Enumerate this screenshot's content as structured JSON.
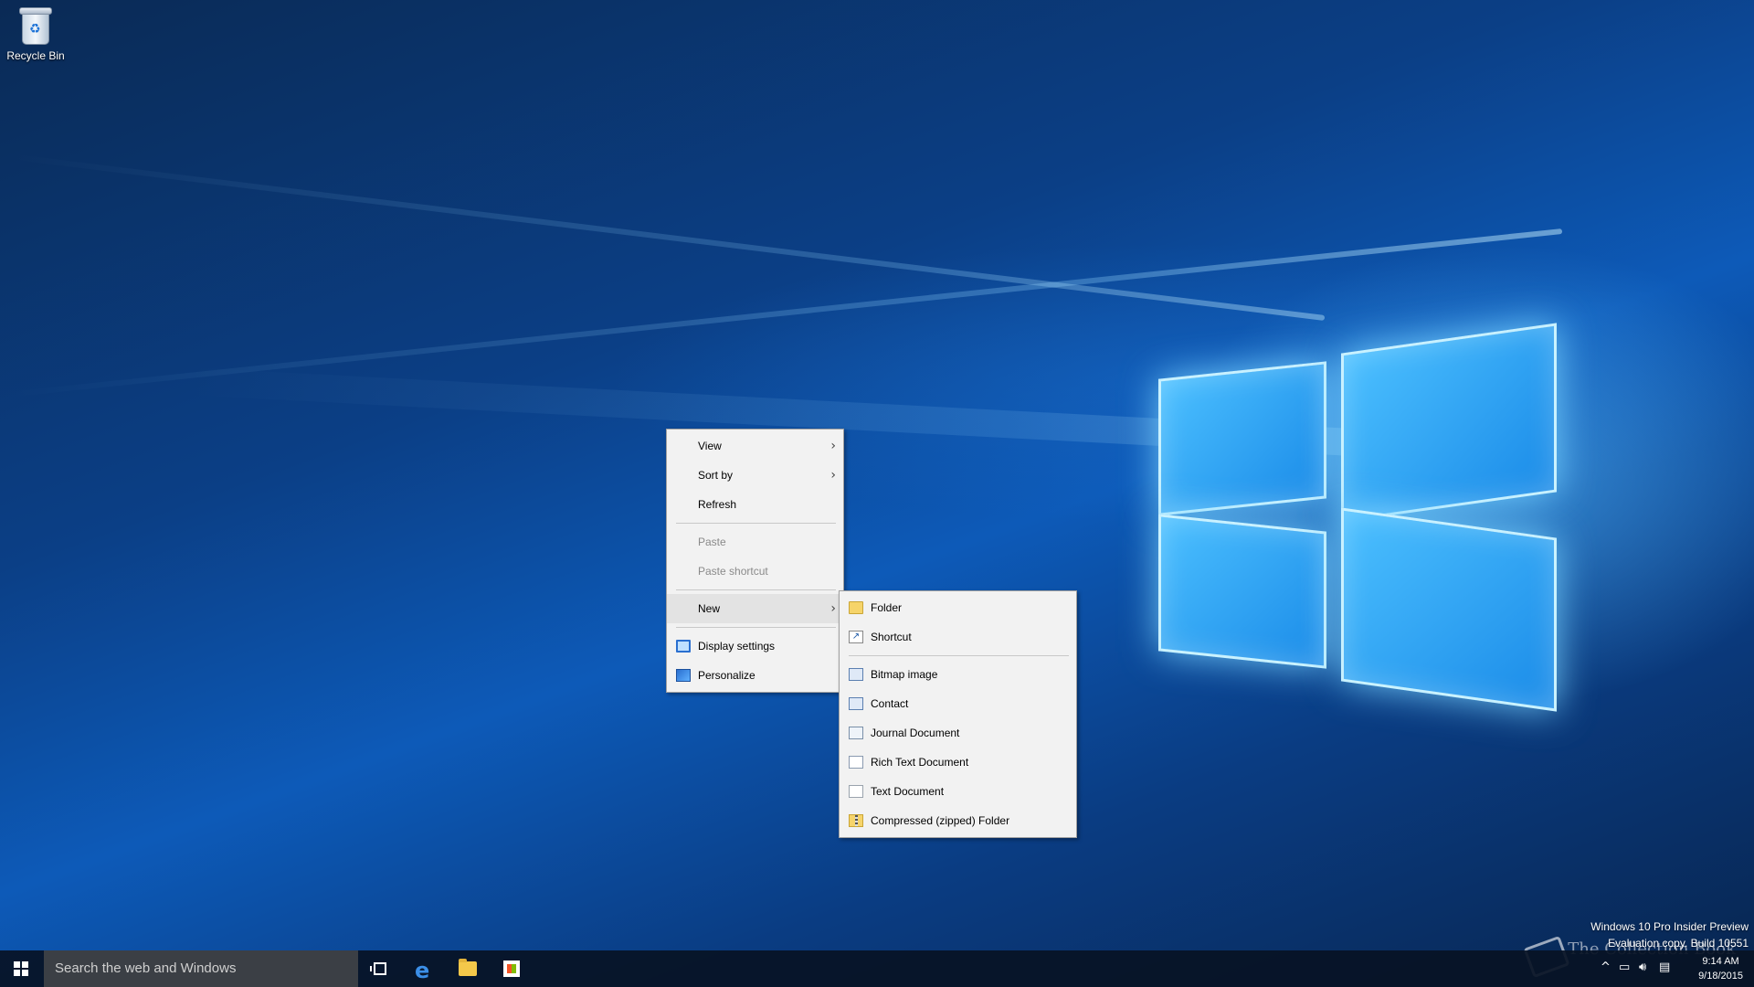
{
  "desktop": {
    "icons": [
      {
        "label": "Recycle Bin",
        "icon": "recycle-bin-icon"
      }
    ]
  },
  "context_menu": {
    "items": [
      {
        "label": "View",
        "submenu": true,
        "enabled": true
      },
      {
        "label": "Sort by",
        "submenu": true,
        "enabled": true
      },
      {
        "label": "Refresh",
        "submenu": false,
        "enabled": true
      },
      {
        "label": "Paste",
        "submenu": false,
        "enabled": false
      },
      {
        "label": "Paste shortcut",
        "submenu": false,
        "enabled": false
      },
      {
        "label": "New",
        "submenu": true,
        "enabled": true,
        "highlighted": true
      },
      {
        "label": "Display settings",
        "icon": "display-settings-icon",
        "enabled": true
      },
      {
        "label": "Personalize",
        "icon": "personalize-icon",
        "enabled": true
      }
    ]
  },
  "new_submenu": {
    "items": [
      {
        "label": "Folder",
        "icon": "folder-icon"
      },
      {
        "label": "Shortcut",
        "icon": "shortcut-icon"
      },
      {
        "label": "Bitmap image",
        "icon": "bitmap-icon"
      },
      {
        "label": "Contact",
        "icon": "contact-icon"
      },
      {
        "label": "Journal Document",
        "icon": "journal-icon"
      },
      {
        "label": "Rich Text Document",
        "icon": "rich-text-icon"
      },
      {
        "label": "Text Document",
        "icon": "text-document-icon"
      },
      {
        "label": "Compressed (zipped) Folder",
        "icon": "zip-folder-icon"
      }
    ]
  },
  "watermark": {
    "line1": "Windows 10 Pro Insider Preview",
    "line2": "Evaluation copy. Build 10551"
  },
  "taskbar": {
    "search_placeholder": "Search the web and Windows",
    "pinned": [
      "task-view-icon",
      "edge-icon",
      "file-explorer-icon",
      "store-icon"
    ],
    "clock_time": "9:14 AM",
    "clock_date": "9/18/2015"
  },
  "brand_watermark": "The Collection Book"
}
